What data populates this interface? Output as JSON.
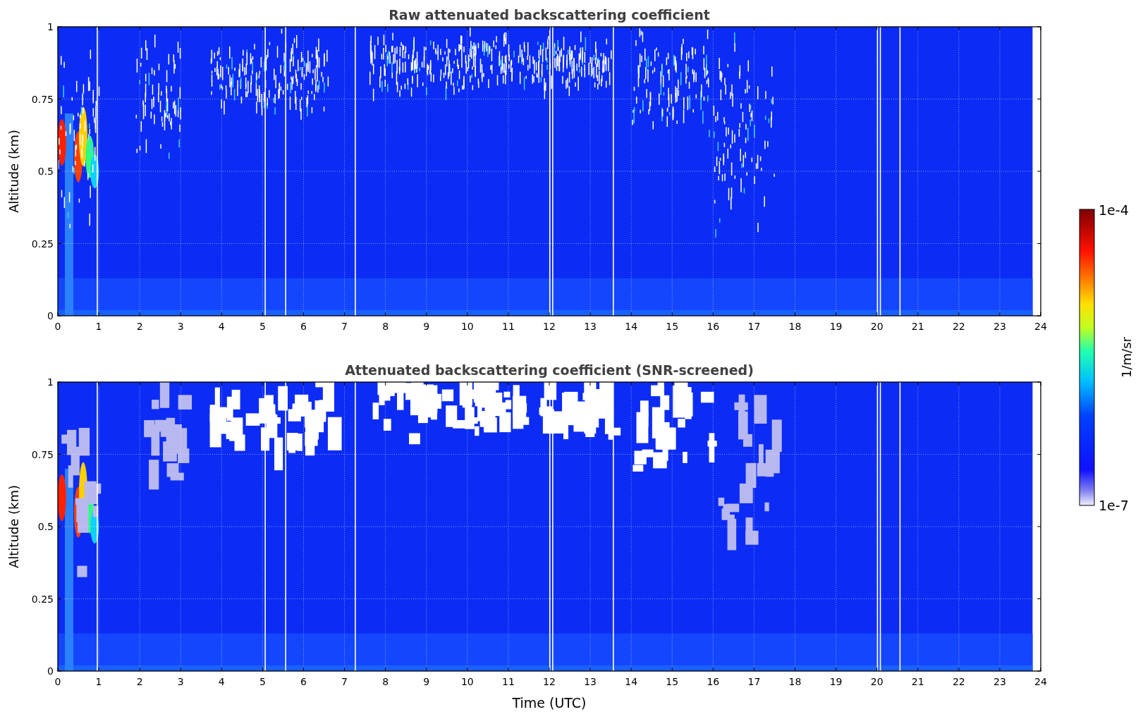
{
  "panels": [
    {
      "title": "Raw attenuated backscattering coefficient",
      "ylabel": "Altitude (km)",
      "yticks": [
        "1",
        "0.75",
        "0.5",
        "0.25",
        "0"
      ],
      "xticks": [
        "0",
        "1",
        "2",
        "3",
        "4",
        "5",
        "6",
        "7",
        "8",
        "9",
        "10",
        "11",
        "12",
        "13",
        "14",
        "15",
        "16",
        "17",
        "18",
        "19",
        "20",
        "21",
        "22",
        "23",
        "24"
      ],
      "screened": false
    },
    {
      "title": "Attenuated backscattering coefficient (SNR-screened)",
      "ylabel": "Altitude (km)",
      "yticks": [
        "1",
        "0.75",
        "0.5",
        "0.25",
        "0"
      ],
      "xticks": [
        "0",
        "1",
        "2",
        "3",
        "4",
        "5",
        "6",
        "7",
        "8",
        "9",
        "10",
        "11",
        "12",
        "13",
        "14",
        "15",
        "16",
        "17",
        "18",
        "19",
        "20",
        "21",
        "22",
        "23",
        "24"
      ],
      "xlabel": "Time (UTC)",
      "screened": true
    }
  ],
  "colorbar": {
    "max_label": "1e-4",
    "min_label": "1e-7",
    "label": "1/m/sr"
  }
}
